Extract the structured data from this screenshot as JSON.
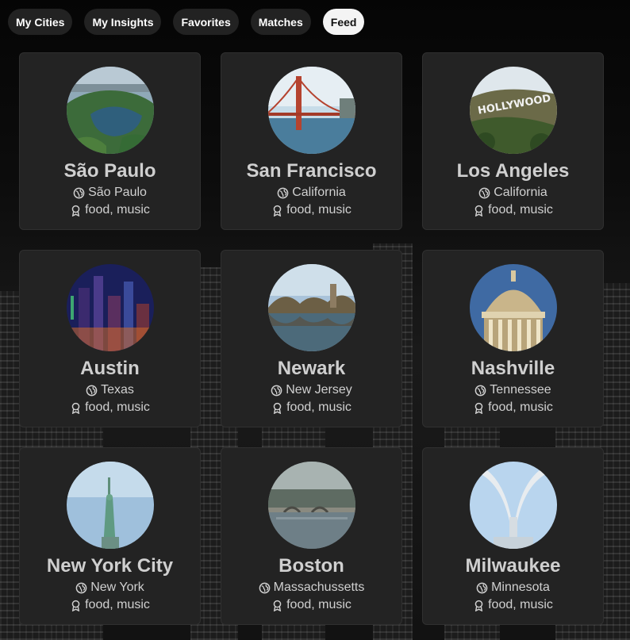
{
  "nav": {
    "tabs": [
      {
        "label": "My Cities",
        "active": false
      },
      {
        "label": "My Insights",
        "active": false
      },
      {
        "label": "Favorites",
        "active": false
      },
      {
        "label": "Matches",
        "active": false
      },
      {
        "label": "Feed",
        "active": true
      }
    ]
  },
  "cards": [
    {
      "city": "São Paulo",
      "region": "São Paulo",
      "interests": "food, music",
      "photo": "park-lake-photo"
    },
    {
      "city": "San Francisco",
      "region": "California",
      "interests": "food, music",
      "photo": "golden-gate-bridge-photo"
    },
    {
      "city": "Los Angeles",
      "region": "California",
      "interests": "food, music",
      "photo": "hollywood-sign-photo"
    },
    {
      "city": "Austin",
      "region": "Texas",
      "interests": "food, music",
      "photo": "night-skyline-photo"
    },
    {
      "city": "Newark",
      "region": "New Jersey",
      "interests": "food, music",
      "photo": "park-reflection-photo"
    },
    {
      "city": "Nashville",
      "region": "Tennessee",
      "interests": "food, music",
      "photo": "capitol-dome-photo"
    },
    {
      "city": "New York City",
      "region": "New York",
      "interests": "food, music",
      "photo": "statue-of-liberty-photo"
    },
    {
      "city": "Boston",
      "region": "Massachussetts",
      "interests": "food, music",
      "photo": "river-bridge-photo"
    },
    {
      "city": "Milwaukee",
      "region": "Minnesota",
      "interests": "food, music",
      "photo": "art-museum-wings-photo"
    }
  ],
  "icons": {
    "region": "globe-icon",
    "interests": "award-ribbon-icon"
  },
  "colors": {
    "card": "#232323",
    "active_tab": "#f4f4f4",
    "tab": "#222222",
    "text": "#d0d0d0"
  }
}
